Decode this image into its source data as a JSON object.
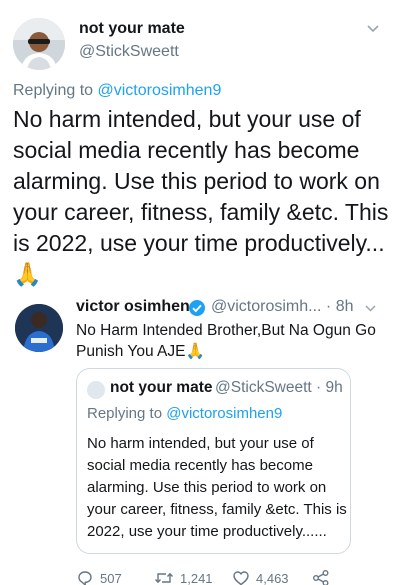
{
  "main_tweet": {
    "display_name": "not your mate",
    "handle": "@StickSweett",
    "replying_prefix": "Replying to ",
    "replying_handle": "@victorosimhen9",
    "text": "No harm intended, but your use of social media recently has become alarming. Use this period to work on your career, fitness, family &etc. This is 2022, use your time productively...🙏"
  },
  "reply_tweet": {
    "display_name": "victor osimhen",
    "handle_time": "@victorosimh... · 8h",
    "text": "No Harm Intended Brother,But Na Ogun Go Punish You AJE🙏"
  },
  "quoted_tweet": {
    "display_name": "not your mate",
    "handle_time": "@StickSweett · 9h",
    "replying_prefix": "Replying to ",
    "replying_handle": "@victorosimhen9",
    "text": "No harm intended, but your use of social media recently has become alarming. Use this period to work on your career, fitness, family &etc. This is 2022, use your time productively......"
  },
  "actions": {
    "reply_count": "507",
    "retweet_count": "1,241",
    "like_count": "4,463"
  },
  "colors": {
    "accent": "#1da1f2",
    "muted": "#657786",
    "text": "#14171a",
    "border": "#cfd9de"
  },
  "icons": [
    "chevron-down-icon",
    "verified-badge-icon",
    "reply-icon",
    "retweet-icon",
    "like-icon",
    "share-icon"
  ]
}
